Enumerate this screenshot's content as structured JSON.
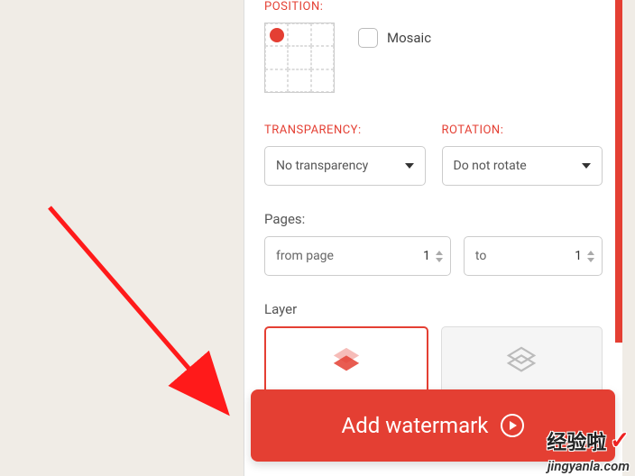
{
  "position": {
    "label": "POSITION:",
    "mosaic_label": "Mosaic",
    "selected_cell": 0
  },
  "transparency": {
    "label": "TRANSPARENCY:",
    "value": "No transparency"
  },
  "rotation": {
    "label": "ROTATION:",
    "value": "Do not rotate"
  },
  "pages": {
    "label": "Pages:",
    "from_label": "from page",
    "from_value": "1",
    "to_label": "to",
    "to_value": "1"
  },
  "layer": {
    "label": "Layer"
  },
  "cta": {
    "label": "Add watermark"
  },
  "brand": {
    "cn": "经验啦",
    "en": "jingyanla.com"
  }
}
